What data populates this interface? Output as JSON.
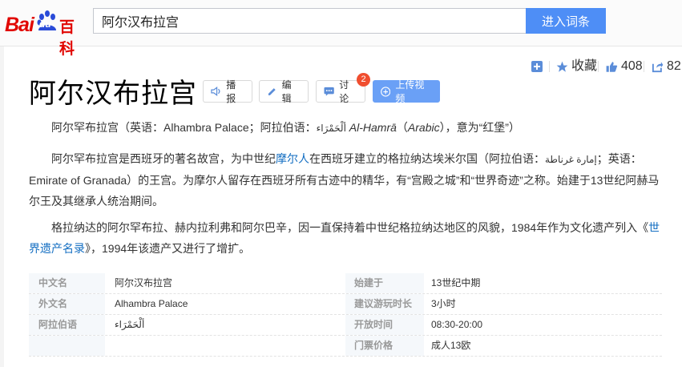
{
  "header": {
    "logo_bai": "Bai",
    "logo_du": "du",
    "logo_baike": "百科",
    "search_value": "阿尔汉布拉宫",
    "search_button": "进入词条"
  },
  "actions": {
    "favorite_label": "收藏",
    "like_count": "408",
    "share_count": "82"
  },
  "title": "阿尔汉布拉宫",
  "title_buttons": {
    "read": "播报",
    "edit": "编辑",
    "discuss": "讨论",
    "discuss_badge": "2",
    "upload_video": "上传视频"
  },
  "paragraphs": {
    "p1_a": "阿尔罕布拉宫（英语：Alhambra Palace；阿拉伯语：",
    "p1_arabic": "ألْحَمْرَاء",
    "p1_italic": "Al-Hamrā",
    "p1_b": "（",
    "p1_italic2": "Arabic",
    "p1_c": "），意为“红堡”）",
    "p2_a": "阿尔罕布拉宫是西班牙的著名故宫，为中世纪",
    "p2_link": "摩尔人",
    "p2_b": "在西班牙建立的格拉纳达埃米尔国（阿拉伯语：",
    "p2_arabic": "إمارة غرناطة",
    "p2_c": "；英语：Emirate of Granada）的王宫。为摩尔人留存在西班牙所有古迹中的精华，有“宫殿之城”和“世界奇迹”之称。始建于13世纪阿赫马尔王及其继承人统治期间。",
    "p3_a": "格拉纳达的阿尔罕布拉、赫内拉利弗和阿尔巴辛，因一直保持着中世纪格拉纳达地区的风貌，1984年作为文化遗产列入《",
    "p3_link": "世界遗产名录",
    "p3_b": "》，1994年该遗产又进行了增扩。"
  },
  "info_left": [
    {
      "key": "中文名",
      "value": "阿尔汉布拉宫"
    },
    {
      "key": "外文名",
      "value": "Alhambra Palace"
    },
    {
      "key": "阿拉伯语",
      "value": "ألْحَمْرَاء"
    }
  ],
  "info_right": [
    {
      "key": "始建于",
      "value": "13世纪中期"
    },
    {
      "key": "建议游玩时长",
      "value": "3小时"
    },
    {
      "key": "开放时间",
      "value": "08:30-20:00"
    },
    {
      "key": "门票价格",
      "value": "成人13欧"
    }
  ],
  "colors": {
    "brand_red": "#e10601",
    "search_blue": "#4e8ef6",
    "link_blue": "#136ec2",
    "video_blue": "#6aa0f6",
    "badge_red": "#f04e2f"
  }
}
